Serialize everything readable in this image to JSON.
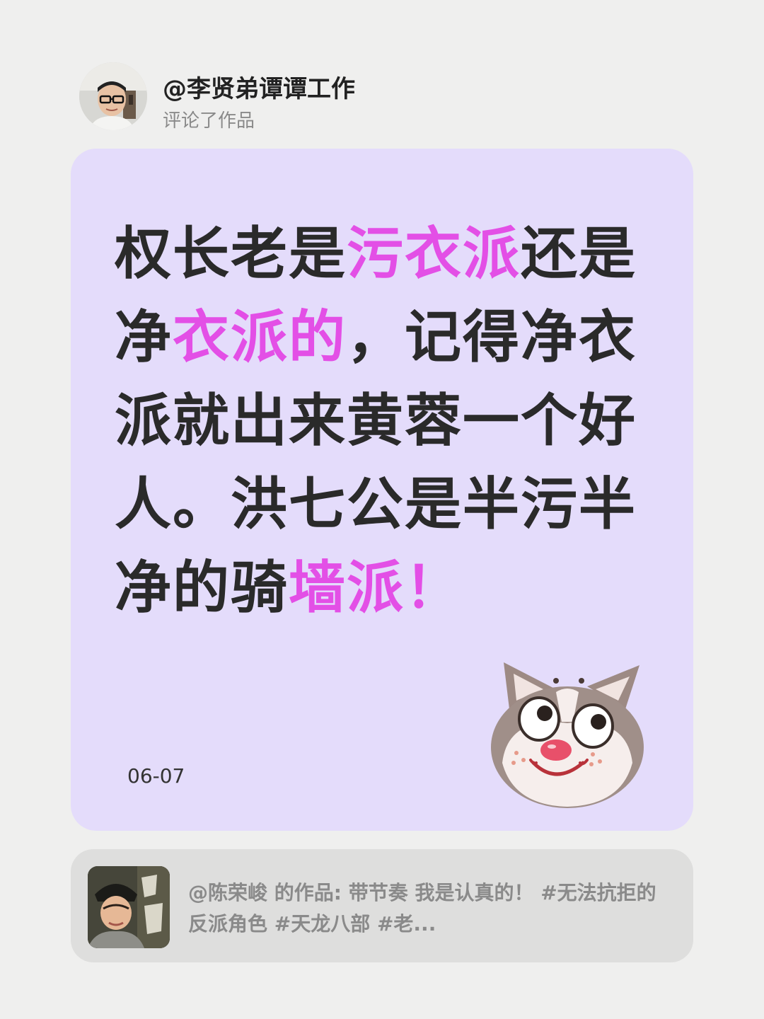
{
  "header": {
    "username": "@李贤弟谭谭工作",
    "action": "评论了作品"
  },
  "comment": {
    "segments": [
      {
        "text": "权长老是",
        "highlight": false
      },
      {
        "text": "污衣派",
        "highlight": true
      },
      {
        "text": "还是净",
        "highlight": false
      },
      {
        "text": "衣派的",
        "highlight": true
      },
      {
        "text": "，记得净衣派就出来黄蓉一个好人。洪七公是半污半净的骑",
        "highlight": false
      },
      {
        "text": "墙派",
        "highlight": true
      },
      {
        "text": "！",
        "highlight": true
      }
    ],
    "date": "06-07",
    "sticker": "husky-dog-face-sticker"
  },
  "work": {
    "description": "@陈荣峻 的作品: 带节奏 我是认真的！ #无法抗拒的反派角色 #天龙八部 #老..."
  },
  "colors": {
    "background": "#efefee",
    "comment_card": "#e4dcfb",
    "highlight": "#e34fe6",
    "text": "#2a2a2a",
    "secondary_text": "#8a8a8a",
    "work_card": "#dededd"
  }
}
